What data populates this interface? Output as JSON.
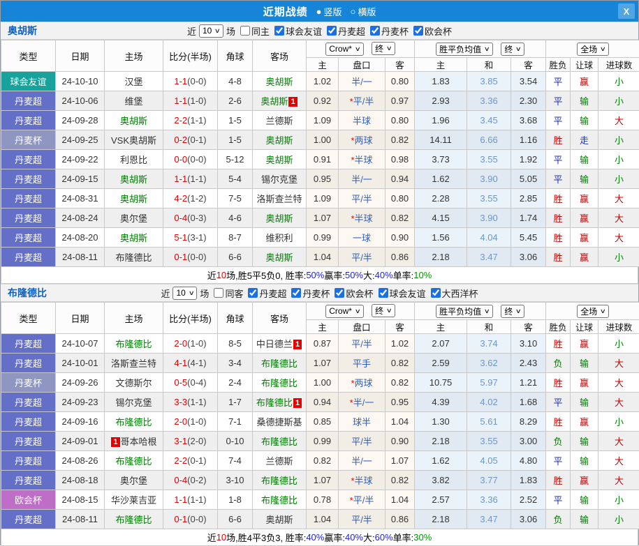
{
  "titlebar": {
    "title": "近期战绩",
    "vertical_label": "竖版",
    "horizontal_label": "横版",
    "close_label": "X",
    "vertical_selected": true
  },
  "colors": {
    "accent_blue": "#1685D8",
    "type_badge": {
      "球会友谊": "#17A39B",
      "丹麦超": "#6470C8",
      "丹麦杯": "#8F96C2",
      "欧会杯": "#BE6EC6"
    },
    "result": {
      "胜": "#CC0000",
      "平": "#2233BB",
      "负": "#008000",
      "赢": "#CC0000",
      "输": "#008000",
      "走": "#2233BB",
      "大": "#CC0000",
      "小": "#008000"
    },
    "highlight_team": "#008000",
    "score_red": "#E60000"
  },
  "table_header": {
    "type": "类型",
    "date": "日期",
    "home": "主场",
    "score": "比分(半场)",
    "corner": "角球",
    "away": "客场",
    "odds_home": "主",
    "odds_handicap": "盘口",
    "odds_away": "客",
    "avg_home": "主",
    "avg_draw": "和",
    "avg_away": "客",
    "result": "胜负",
    "let_ball": "让球",
    "goals": "进球数",
    "odds_source": "Crow*",
    "odds_stage": "终",
    "avg_name": "胜平负均值",
    "avg_stage": "终",
    "scope": "全场"
  },
  "sections": [
    {
      "team": "奥胡斯",
      "filter": {
        "near_label": "近",
        "games": "10",
        "games_suffix": "场",
        "same_label": "同主",
        "same_checked": false,
        "leagues": [
          {
            "label": "球会友谊",
            "checked": true
          },
          {
            "label": "丹麦超",
            "checked": true
          },
          {
            "label": "丹麦杯",
            "checked": true
          },
          {
            "label": "欧会杯",
            "checked": true
          }
        ]
      },
      "rows": [
        {
          "type": "球会友谊",
          "date": "24-10-10",
          "home": "汉堡",
          "home_hl": false,
          "home_badge": "",
          "home_badge_left": false,
          "score": "1-1",
          "half": "(0-0)",
          "corner": "4-8",
          "away": "奥胡斯",
          "away_hl": true,
          "away_badge": "",
          "odds_home": "1.02",
          "handicap": "半/一",
          "odds_away": "0.80",
          "avg_home": "1.83",
          "avg_draw": "3.85",
          "avg_away": "3.54",
          "result": "平",
          "let_result": "赢",
          "goal_result": "小"
        },
        {
          "type": "丹麦超",
          "date": "24-10-06",
          "home": "维堡",
          "home_hl": false,
          "home_badge": "",
          "home_badge_left": false,
          "score": "1-1",
          "half": "(1-0)",
          "corner": "2-6",
          "away": "奥胡斯",
          "away_hl": true,
          "away_badge": "1",
          "odds_home": "0.92",
          "handicap": "*平/半",
          "odds_away": "0.97",
          "avg_home": "2.93",
          "avg_draw": "3.36",
          "avg_away": "2.30",
          "result": "平",
          "let_result": "输",
          "goal_result": "小"
        },
        {
          "type": "丹麦超",
          "date": "24-09-28",
          "home": "奥胡斯",
          "home_hl": true,
          "home_badge": "",
          "home_badge_left": false,
          "score": "2-2",
          "half": "(1-1)",
          "corner": "1-5",
          "away": "兰德斯",
          "away_hl": false,
          "away_badge": "",
          "odds_home": "1.09",
          "handicap": "半球",
          "odds_away": "0.80",
          "avg_home": "1.96",
          "avg_draw": "3.45",
          "avg_away": "3.68",
          "result": "平",
          "let_result": "输",
          "goal_result": "大"
        },
        {
          "type": "丹麦杯",
          "date": "24-09-25",
          "home": "VSK奥胡斯",
          "home_hl": false,
          "home_badge": "",
          "home_badge_left": false,
          "score": "0-2",
          "half": "(0-1)",
          "corner": "1-5",
          "away": "奥胡斯",
          "away_hl": true,
          "away_badge": "",
          "odds_home": "1.00",
          "handicap": "*两球",
          "odds_away": "0.82",
          "avg_home": "14.11",
          "avg_draw": "6.66",
          "avg_away": "1.16",
          "result": "胜",
          "let_result": "走",
          "goal_result": "小"
        },
        {
          "type": "丹麦超",
          "date": "24-09-22",
          "home": "利恩比",
          "home_hl": false,
          "home_badge": "",
          "home_badge_left": false,
          "score": "0-0",
          "half": "(0-0)",
          "corner": "5-12",
          "away": "奥胡斯",
          "away_hl": true,
          "away_badge": "",
          "odds_home": "0.91",
          "handicap": "*半球",
          "odds_away": "0.98",
          "avg_home": "3.73",
          "avg_draw": "3.55",
          "avg_away": "1.92",
          "result": "平",
          "let_result": "输",
          "goal_result": "小"
        },
        {
          "type": "丹麦超",
          "date": "24-09-15",
          "home": "奥胡斯",
          "home_hl": true,
          "home_badge": "",
          "home_badge_left": false,
          "score": "1-1",
          "half": "(1-1)",
          "corner": "5-4",
          "away": "锡尔克堡",
          "away_hl": false,
          "away_badge": "",
          "odds_home": "0.95",
          "handicap": "半/一",
          "odds_away": "0.94",
          "avg_home": "1.62",
          "avg_draw": "3.90",
          "avg_away": "5.05",
          "result": "平",
          "let_result": "输",
          "goal_result": "小"
        },
        {
          "type": "丹麦超",
          "date": "24-08-31",
          "home": "奥胡斯",
          "home_hl": true,
          "home_badge": "",
          "home_badge_left": false,
          "score": "4-2",
          "half": "(1-2)",
          "corner": "7-5",
          "away": "洛斯查兰特",
          "away_hl": false,
          "away_badge": "",
          "odds_home": "1.09",
          "handicap": "平/半",
          "odds_away": "0.80",
          "avg_home": "2.28",
          "avg_draw": "3.55",
          "avg_away": "2.85",
          "result": "胜",
          "let_result": "赢",
          "goal_result": "大"
        },
        {
          "type": "丹麦超",
          "date": "24-08-24",
          "home": "奥尔堡",
          "home_hl": false,
          "home_badge": "",
          "home_badge_left": false,
          "score": "0-4",
          "half": "(0-3)",
          "corner": "4-6",
          "away": "奥胡斯",
          "away_hl": true,
          "away_badge": "",
          "odds_home": "1.07",
          "handicap": "*半球",
          "odds_away": "0.82",
          "avg_home": "4.15",
          "avg_draw": "3.90",
          "avg_away": "1.74",
          "result": "胜",
          "let_result": "赢",
          "goal_result": "大"
        },
        {
          "type": "丹麦超",
          "date": "24-08-20",
          "home": "奥胡斯",
          "home_hl": true,
          "home_badge": "",
          "home_badge_left": false,
          "score": "5-1",
          "half": "(3-1)",
          "corner": "8-7",
          "away": "维积利",
          "away_hl": false,
          "away_badge": "",
          "odds_home": "0.99",
          "handicap": "一球",
          "odds_away": "0.90",
          "avg_home": "1.56",
          "avg_draw": "4.04",
          "avg_away": "5.45",
          "result": "胜",
          "let_result": "赢",
          "goal_result": "大"
        },
        {
          "type": "丹麦超",
          "date": "24-08-11",
          "home": "布隆德比",
          "home_hl": false,
          "home_badge": "",
          "home_badge_left": false,
          "score": "0-1",
          "half": "(0-0)",
          "corner": "6-6",
          "away": "奥胡斯",
          "away_hl": true,
          "away_badge": "",
          "odds_home": "1.04",
          "handicap": "平/半",
          "odds_away": "0.86",
          "avg_home": "2.18",
          "avg_draw": "3.47",
          "avg_away": "3.06",
          "result": "胜",
          "let_result": "赢",
          "goal_result": "小"
        }
      ],
      "summary_parts": [
        {
          "t": "近",
          "c": "#000000"
        },
        {
          "t": "10",
          "c": "#E60000"
        },
        {
          "t": "场,胜5平5负0, 胜率:",
          "c": "#000000"
        },
        {
          "t": "50%",
          "c": "#2222DD"
        },
        {
          "t": " 赢率:",
          "c": "#000000"
        },
        {
          "t": "50%",
          "c": "#2222DD"
        },
        {
          "t": " 大:",
          "c": "#000000"
        },
        {
          "t": "40%",
          "c": "#2222DD"
        },
        {
          "t": " 单率:",
          "c": "#000000"
        },
        {
          "t": "10%",
          "c": "#009900"
        }
      ]
    },
    {
      "team": "布隆德比",
      "filter": {
        "near_label": "近",
        "games": "10",
        "games_suffix": "场",
        "same_label": "同客",
        "same_checked": false,
        "leagues": [
          {
            "label": "丹麦超",
            "checked": true
          },
          {
            "label": "丹麦杯",
            "checked": true
          },
          {
            "label": "欧会杯",
            "checked": true
          },
          {
            "label": "球会友谊",
            "checked": true
          },
          {
            "label": "大西洋杯",
            "checked": true
          }
        ]
      },
      "rows": [
        {
          "type": "丹麦超",
          "date": "24-10-07",
          "home": "布隆德比",
          "home_hl": true,
          "home_badge": "",
          "home_badge_left": false,
          "score": "2-0",
          "half": "(1-0)",
          "corner": "8-5",
          "away": "中日德兰",
          "away_hl": false,
          "away_badge": "1",
          "odds_home": "0.87",
          "handicap": "平/半",
          "odds_away": "1.02",
          "avg_home": "2.07",
          "avg_draw": "3.74",
          "avg_away": "3.10",
          "result": "胜",
          "let_result": "赢",
          "goal_result": "小"
        },
        {
          "type": "丹麦超",
          "date": "24-10-01",
          "home": "洛斯查兰特",
          "home_hl": false,
          "home_badge": "",
          "home_badge_left": false,
          "score": "4-1",
          "half": "(4-1)",
          "corner": "3-4",
          "away": "布隆德比",
          "away_hl": true,
          "away_badge": "",
          "odds_home": "1.07",
          "handicap": "平手",
          "odds_away": "0.82",
          "avg_home": "2.59",
          "avg_draw": "3.62",
          "avg_away": "2.43",
          "result": "负",
          "let_result": "输",
          "goal_result": "大"
        },
        {
          "type": "丹麦杯",
          "date": "24-09-26",
          "home": "文德斯尔",
          "home_hl": false,
          "home_badge": "",
          "home_badge_left": false,
          "score": "0-5",
          "half": "(0-4)",
          "corner": "2-4",
          "away": "布隆德比",
          "away_hl": true,
          "away_badge": "",
          "odds_home": "1.00",
          "handicap": "*两球",
          "odds_away": "0.82",
          "avg_home": "10.75",
          "avg_draw": "5.97",
          "avg_away": "1.21",
          "result": "胜",
          "let_result": "赢",
          "goal_result": "大"
        },
        {
          "type": "丹麦超",
          "date": "24-09-23",
          "home": "锡尔克堡",
          "home_hl": false,
          "home_badge": "",
          "home_badge_left": false,
          "score": "3-3",
          "half": "(1-1)",
          "corner": "1-7",
          "away": "布隆德比",
          "away_hl": true,
          "away_badge": "1",
          "odds_home": "0.94",
          "handicap": "*半/一",
          "odds_away": "0.95",
          "avg_home": "4.39",
          "avg_draw": "4.02",
          "avg_away": "1.68",
          "result": "平",
          "let_result": "输",
          "goal_result": "大"
        },
        {
          "type": "丹麦超",
          "date": "24-09-16",
          "home": "布隆德比",
          "home_hl": true,
          "home_badge": "",
          "home_badge_left": false,
          "score": "2-0",
          "half": "(1-0)",
          "corner": "7-1",
          "away": "桑德捷斯基",
          "away_hl": false,
          "away_badge": "",
          "odds_home": "0.85",
          "handicap": "球半",
          "odds_away": "1.04",
          "avg_home": "1.30",
          "avg_draw": "5.61",
          "avg_away": "8.29",
          "result": "胜",
          "let_result": "赢",
          "goal_result": "小"
        },
        {
          "type": "丹麦超",
          "date": "24-09-01",
          "home": "哥本哈根",
          "home_hl": false,
          "home_badge": "1",
          "home_badge_left": true,
          "score": "3-1",
          "half": "(2-0)",
          "corner": "0-10",
          "away": "布隆德比",
          "away_hl": true,
          "away_badge": "",
          "odds_home": "0.99",
          "handicap": "平/半",
          "odds_away": "0.90",
          "avg_home": "2.18",
          "avg_draw": "3.55",
          "avg_away": "3.00",
          "result": "负",
          "let_result": "输",
          "goal_result": "大"
        },
        {
          "type": "丹麦超",
          "date": "24-08-26",
          "home": "布隆德比",
          "home_hl": true,
          "home_badge": "",
          "home_badge_left": false,
          "score": "2-2",
          "half": "(0-1)",
          "corner": "7-4",
          "away": "兰德斯",
          "away_hl": false,
          "away_badge": "",
          "odds_home": "0.82",
          "handicap": "半/一",
          "odds_away": "1.07",
          "avg_home": "1.62",
          "avg_draw": "4.05",
          "avg_away": "4.80",
          "result": "平",
          "let_result": "输",
          "goal_result": "大"
        },
        {
          "type": "丹麦超",
          "date": "24-08-18",
          "home": "奥尔堡",
          "home_hl": false,
          "home_badge": "",
          "home_badge_left": false,
          "score": "0-4",
          "half": "(0-2)",
          "corner": "3-10",
          "away": "布隆德比",
          "away_hl": true,
          "away_badge": "",
          "odds_home": "1.07",
          "handicap": "*半球",
          "odds_away": "0.82",
          "avg_home": "3.82",
          "avg_draw": "3.77",
          "avg_away": "1.83",
          "result": "胜",
          "let_result": "赢",
          "goal_result": "大"
        },
        {
          "type": "欧会杯",
          "date": "24-08-15",
          "home": "华沙莱吉亚",
          "home_hl": false,
          "home_badge": "",
          "home_badge_left": false,
          "score": "1-1",
          "half": "(1-1)",
          "corner": "1-8",
          "away": "布隆德比",
          "away_hl": true,
          "away_badge": "",
          "odds_home": "0.78",
          "handicap": "*平/半",
          "odds_away": "1.04",
          "avg_home": "2.57",
          "avg_draw": "3.36",
          "avg_away": "2.52",
          "result": "平",
          "let_result": "输",
          "goal_result": "小"
        },
        {
          "type": "丹麦超",
          "date": "24-08-11",
          "home": "布隆德比",
          "home_hl": true,
          "home_badge": "",
          "home_badge_left": false,
          "score": "0-1",
          "half": "(0-0)",
          "corner": "6-6",
          "away": "奥胡斯",
          "away_hl": false,
          "away_badge": "",
          "odds_home": "1.04",
          "handicap": "平/半",
          "odds_away": "0.86",
          "avg_home": "2.18",
          "avg_draw": "3.47",
          "avg_away": "3.06",
          "result": "负",
          "let_result": "输",
          "goal_result": "小"
        }
      ],
      "summary_parts": [
        {
          "t": "近",
          "c": "#000000"
        },
        {
          "t": "10",
          "c": "#E60000"
        },
        {
          "t": "场,胜4平3负3, 胜率:",
          "c": "#000000"
        },
        {
          "t": "40%",
          "c": "#2222DD"
        },
        {
          "t": " 赢率:",
          "c": "#000000"
        },
        {
          "t": "40%",
          "c": "#2222DD"
        },
        {
          "t": " 大:",
          "c": "#000000"
        },
        {
          "t": "60%",
          "c": "#2222DD"
        },
        {
          "t": " 单率:",
          "c": "#000000"
        },
        {
          "t": "30%",
          "c": "#009900"
        }
      ]
    }
  ]
}
